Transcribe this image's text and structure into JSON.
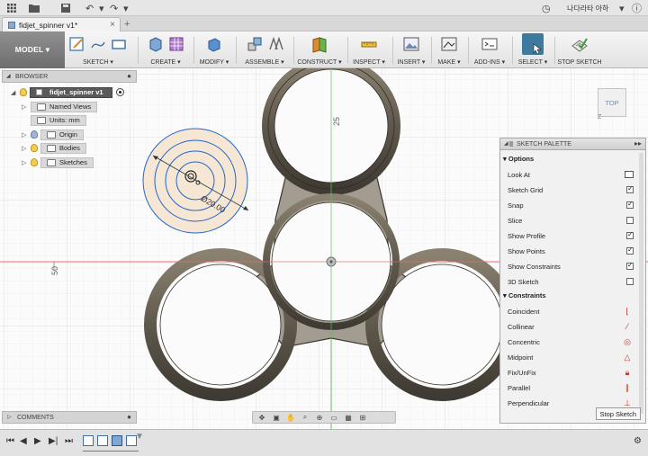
{
  "appbar": {
    "user_name": "나다라타 아하",
    "icons": [
      "grid-icon",
      "folder-icon",
      "save-icon",
      "undo-icon",
      "redo-icon",
      "clock-icon",
      "help-icon"
    ]
  },
  "tab": {
    "doc_title": "fidjet_spinner v1*",
    "close": "×",
    "add": "+"
  },
  "toolbar": {
    "workspace": "MODEL ▾",
    "groups": [
      {
        "label": "SKETCH ▾"
      },
      {
        "label": "CREATE ▾"
      },
      {
        "label": "MODIFY ▾"
      },
      {
        "label": "ASSEMBLE ▾"
      },
      {
        "label": "CONSTRUCT ▾"
      },
      {
        "label": "INSPECT ▾"
      },
      {
        "label": "INSERT ▾"
      },
      {
        "label": "MAKE ▾"
      },
      {
        "label": "ADD-INS ▾"
      },
      {
        "label": "SELECT ▾"
      },
      {
        "label": "STOP SKETCH"
      }
    ]
  },
  "browser": {
    "header": "BROWSER",
    "root": "fidjet_spinner v1",
    "items": [
      "Named Views",
      "Units: mm",
      "Origin",
      "Bodies",
      "Sketches"
    ]
  },
  "comments": {
    "label": "COMMENTS"
  },
  "canvas": {
    "dim_label": "Ø20.00",
    "ruler_y": "25",
    "ruler_x": "50"
  },
  "viewcube": {
    "face": "TOP",
    "axis": "Z"
  },
  "palette": {
    "header": "SKETCH PALETTE",
    "options_title": "Options",
    "options": [
      {
        "name": "Look At",
        "checked": null
      },
      {
        "name": "Sketch Grid",
        "checked": true
      },
      {
        "name": "Snap",
        "checked": true
      },
      {
        "name": "Slice",
        "checked": false
      },
      {
        "name": "Show Profile",
        "checked": true
      },
      {
        "name": "Show Points",
        "checked": true
      },
      {
        "name": "Show Constraints",
        "checked": true
      },
      {
        "name": "3D Sketch",
        "checked": false
      }
    ],
    "constraints_title": "Constraints",
    "constraints": [
      {
        "name": "Coincident",
        "icon": "coincident-icon"
      },
      {
        "name": "Collinear",
        "icon": "collinear-icon"
      },
      {
        "name": "Concentric",
        "icon": "concentric-icon"
      },
      {
        "name": "Midpoint",
        "icon": "midpoint-icon"
      },
      {
        "name": "Fix/UnFix",
        "icon": "lock-icon"
      },
      {
        "name": "Parallel",
        "icon": "parallel-icon"
      },
      {
        "name": "Perpendicular",
        "icon": "perpendicular-icon"
      }
    ],
    "stop_label": "Stop Sketch"
  }
}
